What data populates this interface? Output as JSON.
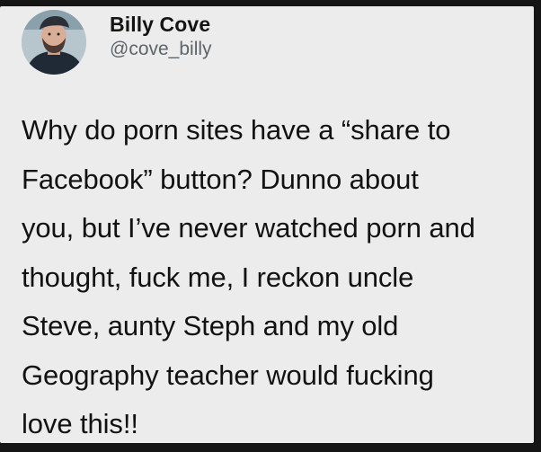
{
  "author": {
    "display_name": "Billy Cove",
    "handle": "@cove_billy"
  },
  "tweet": {
    "text": "Why do porn sites have a “share to\nFacebook” button? Dunno about\nyou, but I’ve never watched porn and\nthought, fuck me, I reckon uncle\nSteve, aunty Steph and my old\nGeography teacher would fucking\nlove this!!"
  },
  "icons": {
    "avatar": "profile-photo"
  }
}
